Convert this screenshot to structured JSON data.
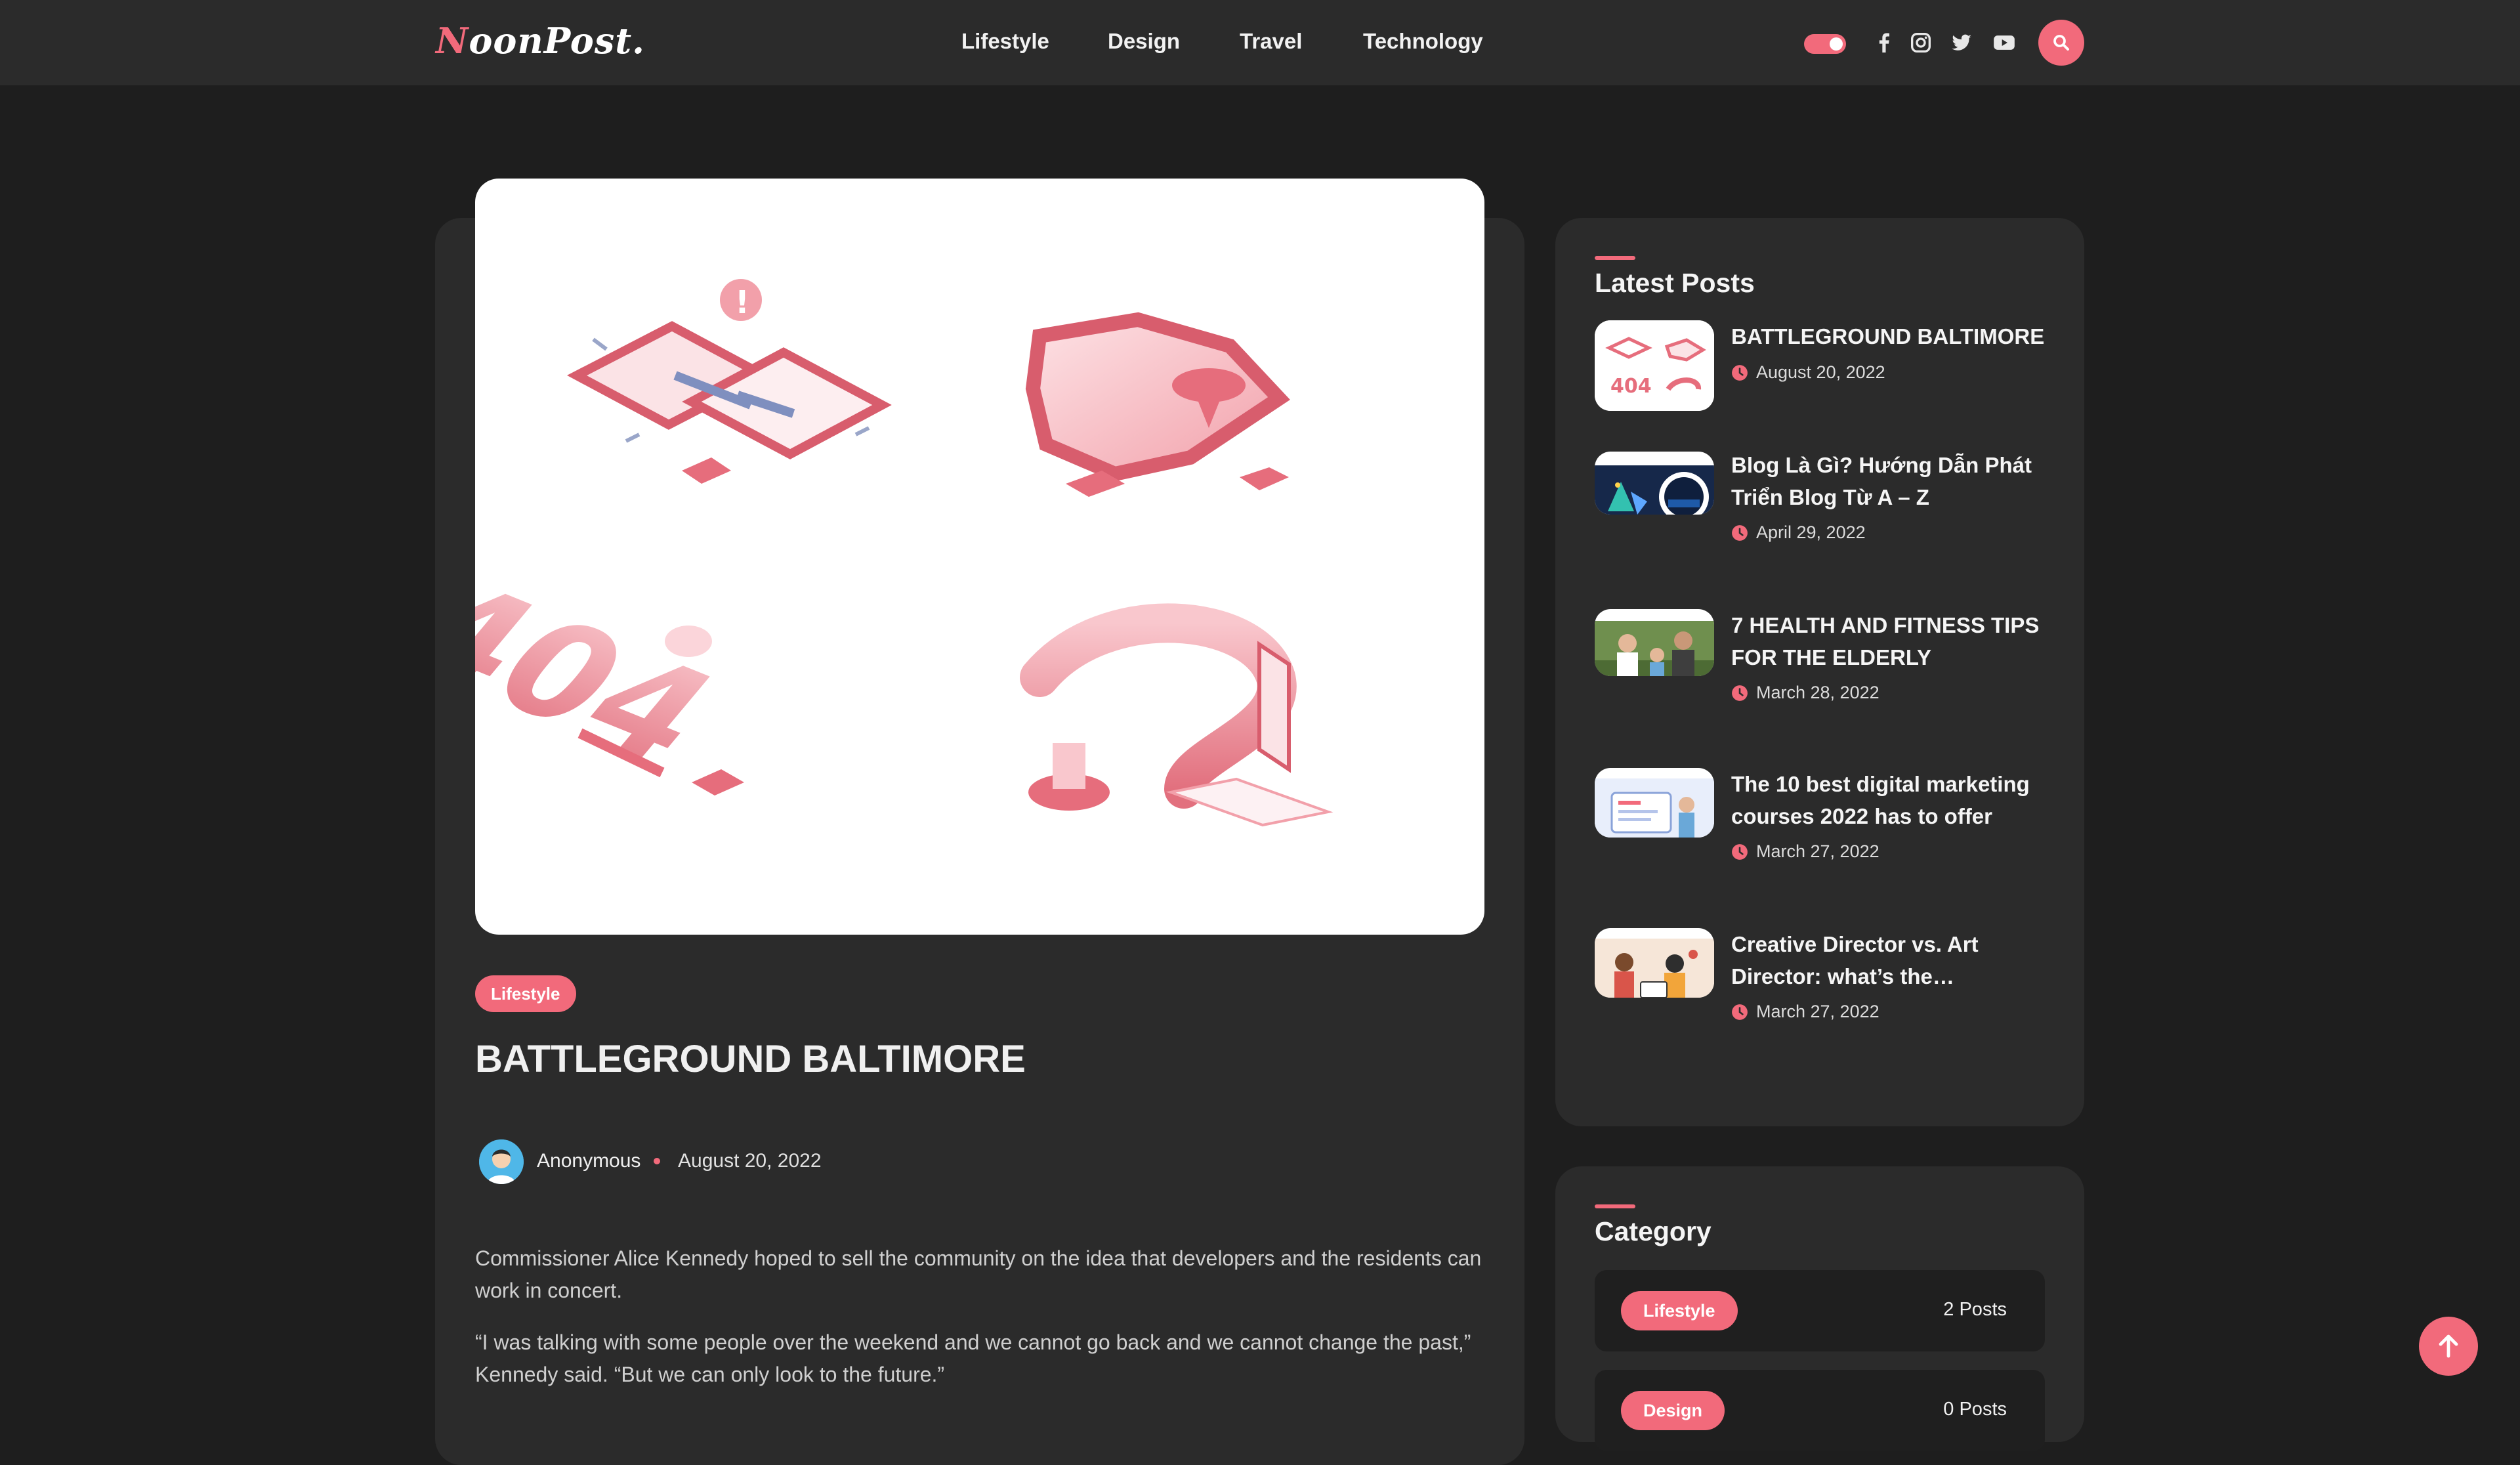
{
  "header": {
    "logo": "NoonPost.",
    "nav": [
      "Lifestyle",
      "Design",
      "Travel",
      "Technology"
    ],
    "social_icons": [
      "facebook-icon",
      "instagram-icon",
      "twitter-icon",
      "youtube-icon"
    ],
    "search_icon": "search-icon",
    "theme_toggle_on": true
  },
  "post": {
    "hero_image": "404 error isometric illustrations",
    "category": "Lifestyle",
    "title": "BATTLEGROUND BALTIMORE",
    "author": "Anonymous",
    "date": "August 20, 2022",
    "paragraphs": [
      "Commissioner Alice Kennedy hoped to sell the community on the idea that developers and the residents can work in concert.",
      "“I was talking with some people over the weekend and we cannot go back and we cannot change the past,” Kennedy said. “But we can only look to the future.”"
    ]
  },
  "latest_posts": {
    "title": "Latest Posts",
    "items": [
      {
        "title": "BATTLEGROUND BALTIMORE",
        "date": "August 20, 2022"
      },
      {
        "title": "Blog Là Gì? Hướng Dẫn Phát Triển Blog Từ A – Z",
        "date": "April 29, 2022"
      },
      {
        "title": "7 HEALTH AND FITNESS TIPS FOR THE ELDERLY",
        "date": "March 28, 2022"
      },
      {
        "title": "The 10 best digital marketing courses 2022 has to offer",
        "date": "March 27, 2022"
      },
      {
        "title": "Creative Director vs. Art Director: what’s the…",
        "date": "March 27, 2022"
      }
    ]
  },
  "categories": {
    "title": "Category",
    "items": [
      {
        "name": "Lifestyle",
        "count": "2 Posts"
      },
      {
        "name": "Design",
        "count": "0 Posts"
      }
    ]
  },
  "colors": {
    "accent": "#f26a7b",
    "background": "#1e1e1e",
    "card": "#2b2b2b",
    "topbar": "#2b2b2b"
  },
  "scroll_top_icon": "arrow-up-icon"
}
